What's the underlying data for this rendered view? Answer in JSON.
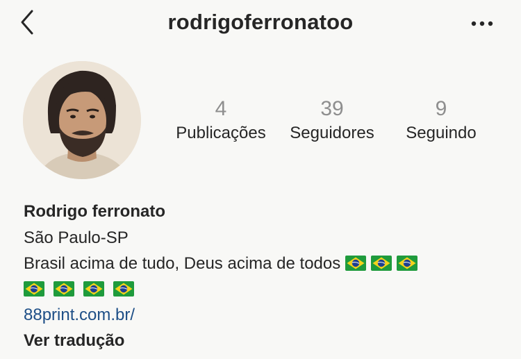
{
  "header": {
    "username": "rodrigoferronatoo",
    "back_icon": "chevron-left-icon",
    "more_icon": "more-horizontal-icon"
  },
  "profile": {
    "avatar_icon": "profile-photo",
    "stats": [
      {
        "value": "4",
        "label": "Publicações"
      },
      {
        "value": "39",
        "label": "Seguidores"
      },
      {
        "value": "9",
        "label": "Seguindo"
      }
    ]
  },
  "bio": {
    "name": "Rodrigo ferronato",
    "location": "São Paulo-SP",
    "text": "Brasil acima de tudo, Deus acima de todos",
    "flag_icon": "brazil-flag-icon",
    "flags_inline_count": 3,
    "flags_second_row_count": 4,
    "link": "88print.com.br/",
    "translate_label": "Ver tradução"
  },
  "colors": {
    "background": "#f8f8f6",
    "text": "#262626",
    "muted": "#8e8e8e",
    "link": "#1e4f87"
  }
}
